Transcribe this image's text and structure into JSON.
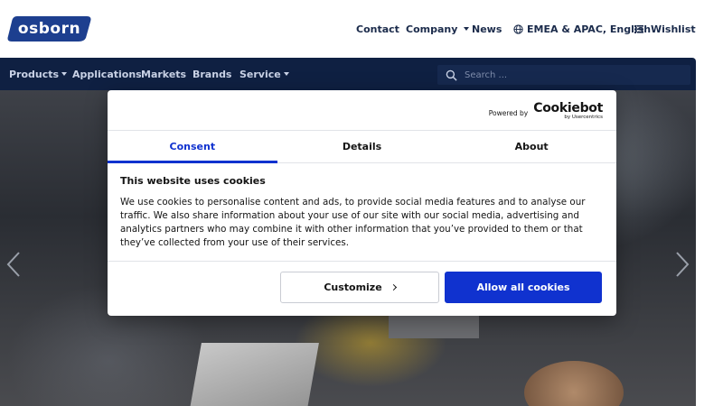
{
  "header": {
    "logo_text": "osborn",
    "nav": {
      "contact": "Contact",
      "company": "Company",
      "news": "News",
      "region": "EMEA & APAC, English",
      "wishlist": "Wishlist"
    }
  },
  "mainnav": {
    "products": "Products",
    "applications": "Applications",
    "markets": "Markets",
    "brands": "Brands",
    "service": "Service",
    "search_placeholder": "Search ..."
  },
  "cookie_dialog": {
    "powered_by": "Powered by",
    "brand": "Cookiebot",
    "brand_sub": "by Usercentrics",
    "tabs": [
      "Consent",
      "Details",
      "About"
    ],
    "active_tab": "Consent",
    "title": "This website uses cookies",
    "text": "We use cookies to personalise content and ads, to provide social media features and to analyse our traffic. We also share information about your use of our site with our social media, advertising and analytics partners who may combine it with other information that you’ve provided to them or that they’ve collected from your use of their services.",
    "customize_label": "Customize",
    "allow_label": "Allow all cookies"
  },
  "colors": {
    "brand_navy": "#0f2042",
    "logo_blue": "#1d3f8f",
    "accent_blue": "#1032cf"
  },
  "icons": {
    "search": "search-icon",
    "globe": "globe-icon",
    "wishlist": "list-icon",
    "prev": "chevron-left-icon",
    "next": "chevron-right-icon"
  }
}
